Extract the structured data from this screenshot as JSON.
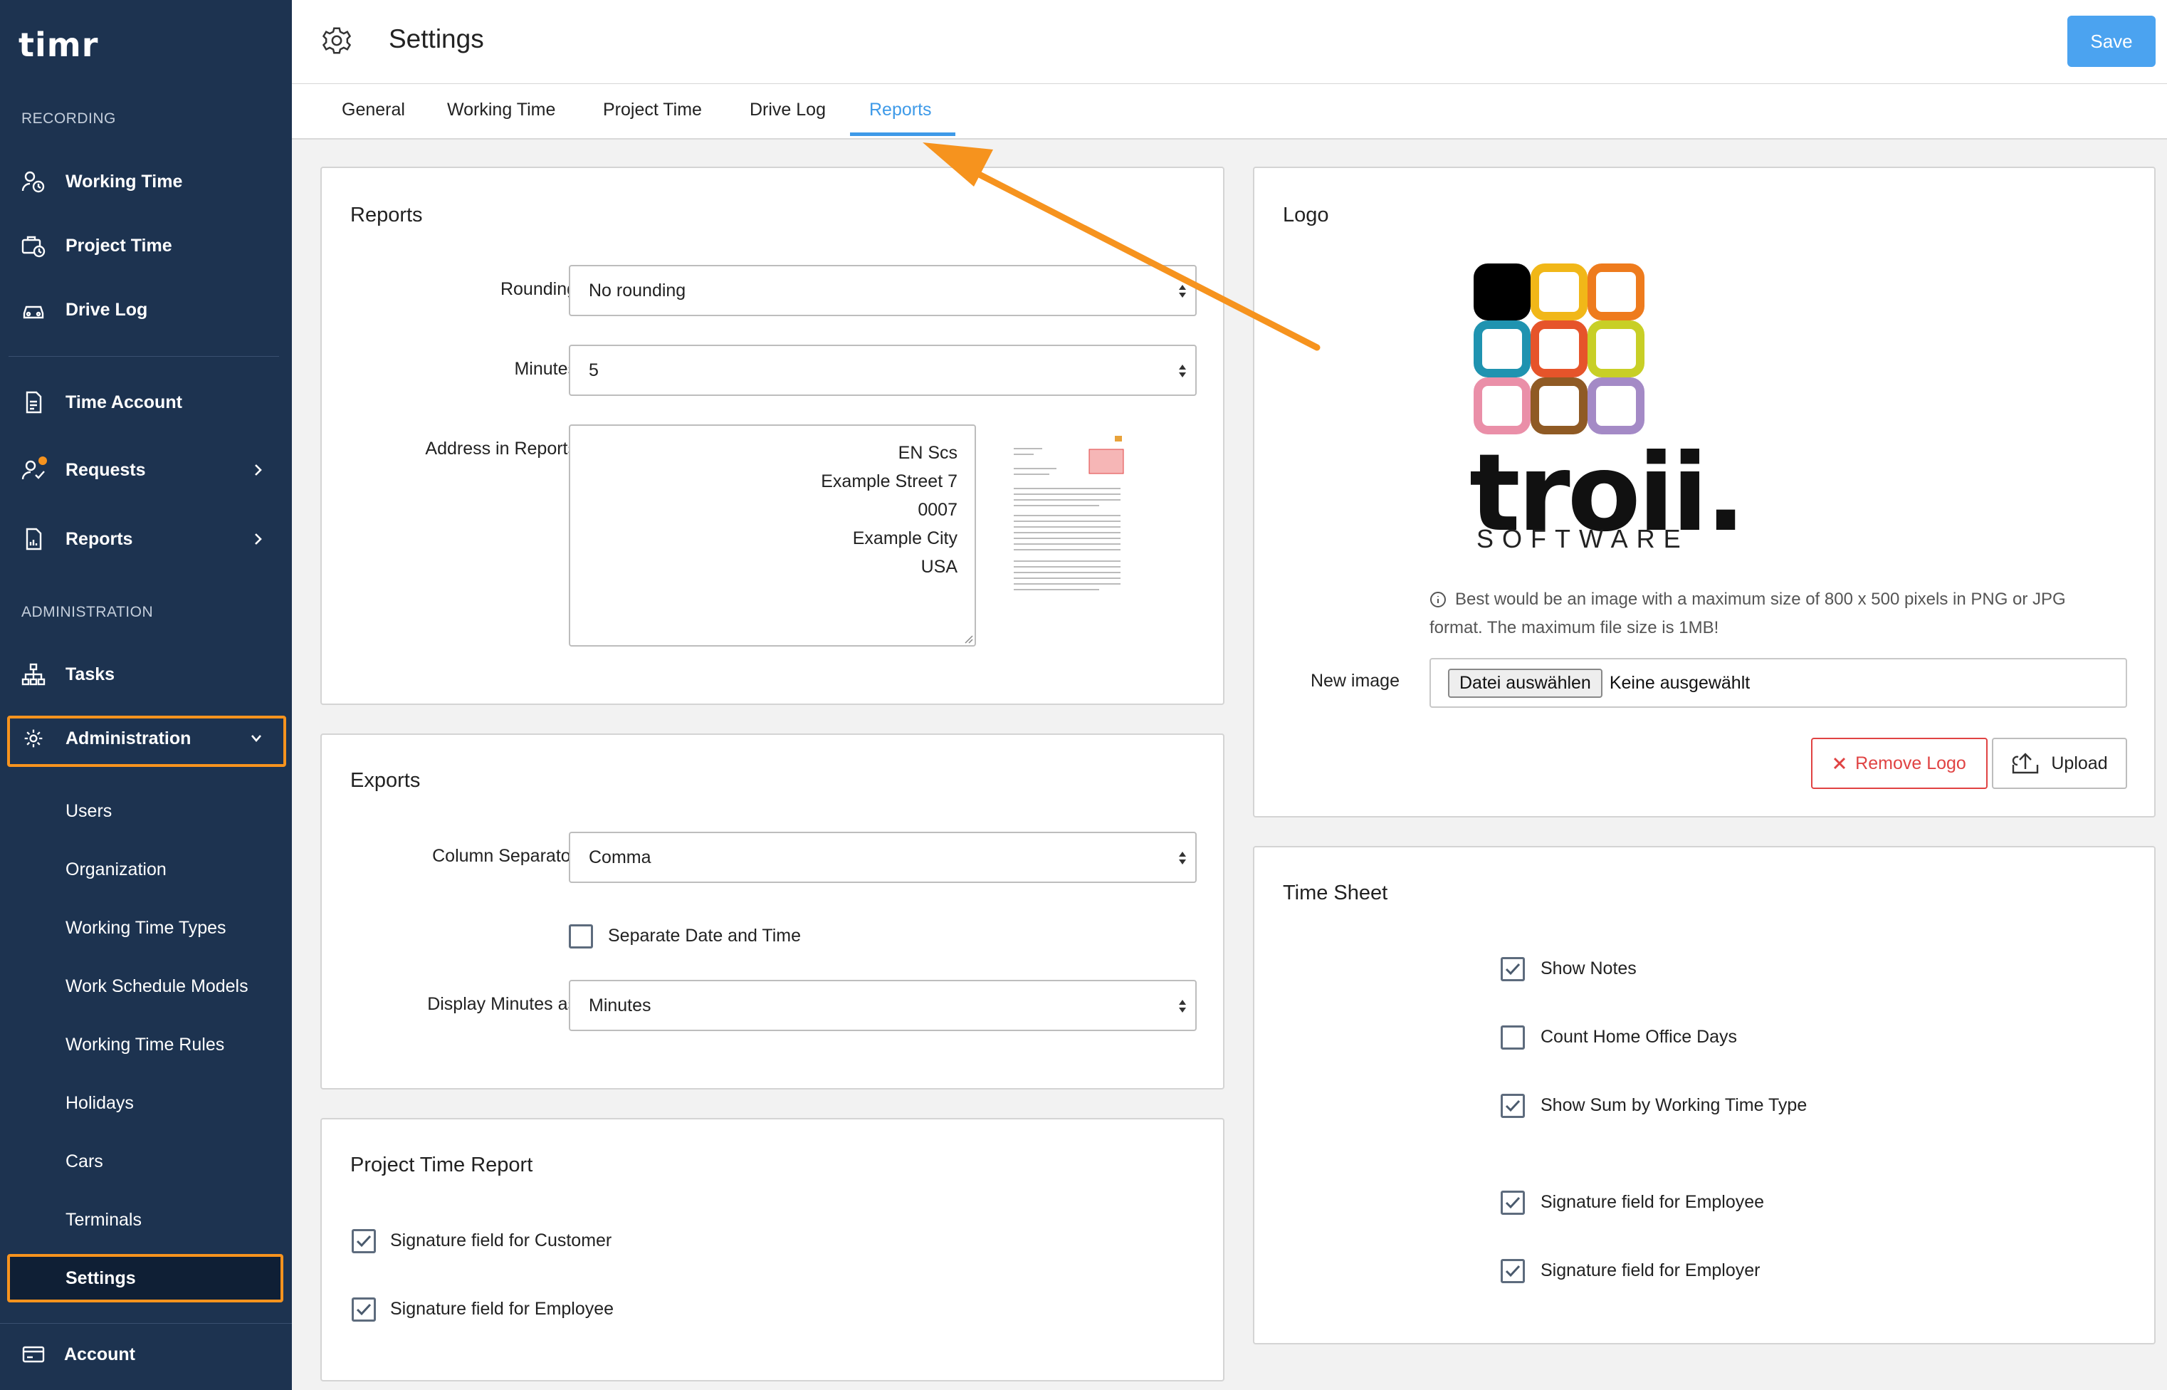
{
  "app": {
    "brand": "timr"
  },
  "sidebar": {
    "recording_label": "RECORDING",
    "admin_label": "ADMINISTRATION",
    "items": [
      {
        "label": "Working Time",
        "icon": "user-clock-icon"
      },
      {
        "label": "Project Time",
        "icon": "briefcase-clock-icon"
      },
      {
        "label": "Drive Log",
        "icon": "car-icon"
      },
      {
        "label": "Time Account",
        "icon": "document-icon"
      },
      {
        "label": "Requests",
        "icon": "user-check-icon"
      },
      {
        "label": "Reports",
        "icon": "report-icon"
      },
      {
        "label": "Tasks",
        "icon": "hierarchy-icon"
      },
      {
        "label": "Administration",
        "icon": "gear-icon"
      }
    ],
    "admin_sub": [
      "Users",
      "Organization",
      "Working Time Types",
      "Work Schedule Models",
      "Working Time Rules",
      "Holidays",
      "Cars",
      "Terminals",
      "Settings"
    ],
    "account": {
      "label": "Account",
      "icon": "credit-card-icon"
    }
  },
  "header": {
    "title": "Settings",
    "save_label": "Save"
  },
  "tabs": [
    {
      "label": "General",
      "active": false
    },
    {
      "label": "Working Time",
      "active": false
    },
    {
      "label": "Project Time",
      "active": false
    },
    {
      "label": "Drive Log",
      "active": false
    },
    {
      "label": "Reports",
      "active": true
    }
  ],
  "reports": {
    "title": "Reports",
    "rounding_label": "Rounding",
    "rounding_value": "No rounding",
    "minutes_label": "Minutes",
    "minutes_value": "5",
    "address_label": "Address in Reports",
    "address_lines": [
      "EN Scs",
      "Example Street 7",
      "0007",
      "Example City",
      "USA"
    ]
  },
  "exports": {
    "title": "Exports",
    "separator_label": "Column Separator",
    "separator_value": "Comma",
    "separate_dt_label": "Separate Date and Time",
    "separate_dt_checked": false,
    "display_minutes_label": "Display Minutes as",
    "display_minutes_value": "Minutes"
  },
  "project_report": {
    "title": "Project Time Report",
    "items": [
      {
        "label": "Signature field for Customer",
        "checked": true
      },
      {
        "label": "Signature field for Employee",
        "checked": true
      }
    ]
  },
  "logo": {
    "title": "Logo",
    "brand_word": "troii.",
    "brand_sub": "SOFTWARE",
    "info_line1": "Best would be an image with a maximum size of 800 x 500 pixels in PNG or JPG",
    "info_line2": "format. The maximum file size is 1MB!",
    "new_image_label": "New image",
    "choose_file_label": "Datei auswählen",
    "no_file_label": "Keine ausgewählt",
    "remove_label": "Remove Logo",
    "upload_label": "Upload",
    "tile_colors": [
      "#000000",
      "#f1b718",
      "#ee7b1d",
      "#1f93b0",
      "#e6542a",
      "#c8cf26",
      "#ea8fa8",
      "#8f5a24",
      "#a48ac6"
    ]
  },
  "timesheet": {
    "title": "Time Sheet",
    "items": [
      {
        "label": "Show Notes",
        "checked": true
      },
      {
        "label": "Count Home Office Days",
        "checked": false
      },
      {
        "label": "Show Sum by Working Time Type",
        "checked": true
      },
      {
        "label": "Signature field for Employee",
        "checked": true
      },
      {
        "label": "Signature field for Employer",
        "checked": true
      }
    ]
  },
  "colors": {
    "sidebar": "#1d3350",
    "accent": "#3e9ae8",
    "highlight": "#f6931e",
    "danger": "#e04343"
  }
}
